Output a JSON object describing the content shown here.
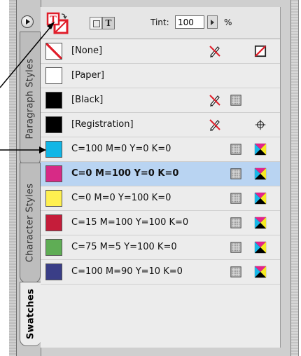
{
  "panel": {
    "tabs": [
      {
        "label": "Paragraph Styles"
      },
      {
        "label": "Character Styles"
      },
      {
        "label": "Swatches"
      }
    ],
    "tint": {
      "label": "Tint:",
      "value": "100",
      "unit": "%"
    }
  },
  "swatches": [
    {
      "name": "[None]",
      "color": "#ffffff",
      "kind": "none",
      "edit": "no-edit",
      "type": null,
      "mode": "none"
    },
    {
      "name": "[Paper]",
      "color": "#ffffff",
      "kind": "paper",
      "edit": null,
      "type": null,
      "mode": null
    },
    {
      "name": "[Black]",
      "color": "#000000",
      "kind": "black",
      "edit": "no-edit",
      "type": "process",
      "mode": null
    },
    {
      "name": "[Registration]",
      "color": "#000000",
      "kind": "registration",
      "edit": "no-edit",
      "type": null,
      "mode": "registration"
    },
    {
      "name": "C=100 M=0 Y=0 K=0",
      "color": "#11b6e6",
      "kind": "process",
      "edit": null,
      "type": "process",
      "mode": "cmyk"
    },
    {
      "name": "C=0 M=100 Y=0 K=0",
      "color": "#d72a86",
      "kind": "process",
      "edit": null,
      "type": "process",
      "mode": "cmyk",
      "selected": true
    },
    {
      "name": "C=0 M=0 Y=100 K=0",
      "color": "#fff050",
      "kind": "process",
      "edit": null,
      "type": "process",
      "mode": "cmyk"
    },
    {
      "name": "C=15 M=100 Y=100 K=0",
      "color": "#c51d3a",
      "kind": "process",
      "edit": null,
      "type": "process",
      "mode": "cmyk"
    },
    {
      "name": "C=75 M=5 Y=100 K=0",
      "color": "#5fad55",
      "kind": "process",
      "edit": null,
      "type": "process",
      "mode": "cmyk"
    },
    {
      "name": "C=100 M=90 Y=10 K=0",
      "color": "#3a3e87",
      "kind": "process",
      "edit": null,
      "type": "process",
      "mode": "cmyk"
    }
  ]
}
